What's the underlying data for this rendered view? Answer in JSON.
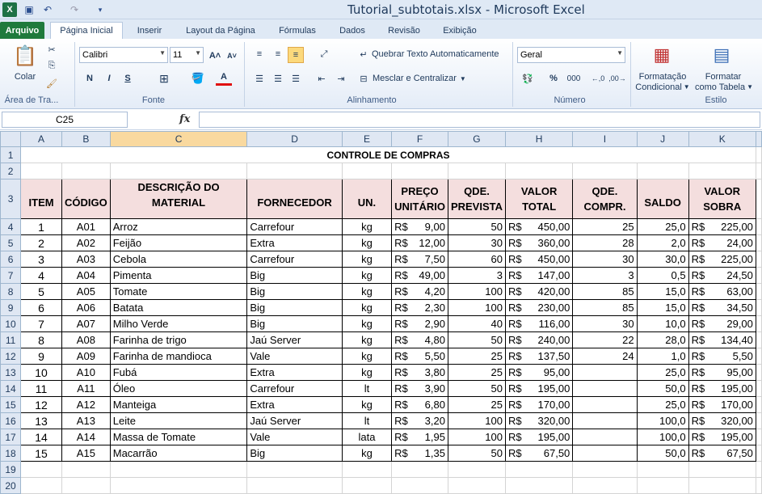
{
  "window": {
    "title": "Tutorial_subtotais.xlsx  -  Microsoft Excel"
  },
  "tabs": [
    "Arquivo",
    "Página Inicial",
    "Inserir",
    "Layout da Página",
    "Fórmulas",
    "Dados",
    "Revisão",
    "Exibição"
  ],
  "ribbon": {
    "clipboard": {
      "paste": "Colar",
      "label": "Área de Tra..."
    },
    "font": {
      "name": "Calibri",
      "size": "11",
      "bold": "N",
      "italic": "I",
      "underline": "S",
      "label": "Fonte"
    },
    "alignment": {
      "wrap": "Quebrar Texto Automaticamente",
      "merge": "Mesclar e Centralizar",
      "label": "Alinhamento"
    },
    "number": {
      "format": "Geral",
      "percent": "%",
      "thousands": "000",
      "label": "Número"
    },
    "styles": {
      "conditional_1": "Formatação",
      "conditional_2": "Condicional",
      "table_1": "Formatar",
      "table_2": "como Tabela",
      "label": "Estilo"
    }
  },
  "formula_bar": {
    "cell": "C25",
    "fx": "fx",
    "value": ""
  },
  "columns": [
    "A",
    "B",
    "C",
    "D",
    "E",
    "F",
    "G",
    "H",
    "I",
    "J",
    "K"
  ],
  "sheet": {
    "title": "CONTROLE DE COMPRAS",
    "headers": [
      "ITEM",
      "CÓDIGO",
      "DESCRIÇÃO DO MATERIAL",
      "FORNECEDOR",
      "UN.",
      "PREÇO UNITÁRIO",
      "QDE. PREVISTA",
      "VALOR TOTAL",
      "QDE. COMPR.",
      "SALDO",
      "VALOR SOBRA"
    ],
    "currency": "R$",
    "rows": [
      [
        "1",
        "A01",
        "Arroz",
        "Carrefour",
        "kg",
        "9,00",
        "50",
        "450,00",
        "25",
        "25,0",
        "225,00"
      ],
      [
        "2",
        "A02",
        "Feijão",
        "Extra",
        "kg",
        "12,00",
        "30",
        "360,00",
        "28",
        "2,0",
        "24,00"
      ],
      [
        "3",
        "A03",
        "Cebola",
        "Carrefour",
        "kg",
        "7,50",
        "60",
        "450,00",
        "30",
        "30,0",
        "225,00"
      ],
      [
        "4",
        "A04",
        "Pimenta",
        "Big",
        "kg",
        "49,00",
        "3",
        "147,00",
        "3",
        "0,5",
        "24,50"
      ],
      [
        "5",
        "A05",
        "Tomate",
        "Big",
        "kg",
        "4,20",
        "100",
        "420,00",
        "85",
        "15,0",
        "63,00"
      ],
      [
        "6",
        "A06",
        "Batata",
        "Big",
        "kg",
        "2,30",
        "100",
        "230,00",
        "85",
        "15,0",
        "34,50"
      ],
      [
        "7",
        "A07",
        "Milho Verde",
        "Big",
        "kg",
        "2,90",
        "40",
        "116,00",
        "30",
        "10,0",
        "29,00"
      ],
      [
        "8",
        "A08",
        "Farinha de trigo",
        "Jaú Server",
        "kg",
        "4,80",
        "50",
        "240,00",
        "22",
        "28,0",
        "134,40"
      ],
      [
        "9",
        "A09",
        "Farinha de mandioca",
        "Vale",
        "kg",
        "5,50",
        "25",
        "137,50",
        "24",
        "1,0",
        "5,50"
      ],
      [
        "10",
        "A10",
        "Fubá",
        "Extra",
        "kg",
        "3,80",
        "25",
        "95,00",
        "",
        "25,0",
        "95,00"
      ],
      [
        "11",
        "A11",
        "Óleo",
        "Carrefour",
        "lt",
        "3,90",
        "50",
        "195,00",
        "",
        "50,0",
        "195,00"
      ],
      [
        "12",
        "A12",
        "Manteiga",
        "Extra",
        "kg",
        "6,80",
        "25",
        "170,00",
        "",
        "25,0",
        "170,00"
      ],
      [
        "13",
        "A13",
        "Leite",
        "Jaú Server",
        "lt",
        "3,20",
        "100",
        "320,00",
        "",
        "100,0",
        "320,00"
      ],
      [
        "14",
        "A14",
        "Massa de Tomate",
        "Vale",
        "lata",
        "1,95",
        "100",
        "195,00",
        "",
        "100,0",
        "195,00"
      ],
      [
        "15",
        "A15",
        "Macarrão",
        "Big",
        "kg",
        "1,35",
        "50",
        "67,50",
        "",
        "50,0",
        "67,50"
      ]
    ]
  },
  "colors": {
    "header_fill": "#f4dede",
    "ribbon_bg": "#dfe9f5",
    "file_tab": "#1f7a3c"
  }
}
